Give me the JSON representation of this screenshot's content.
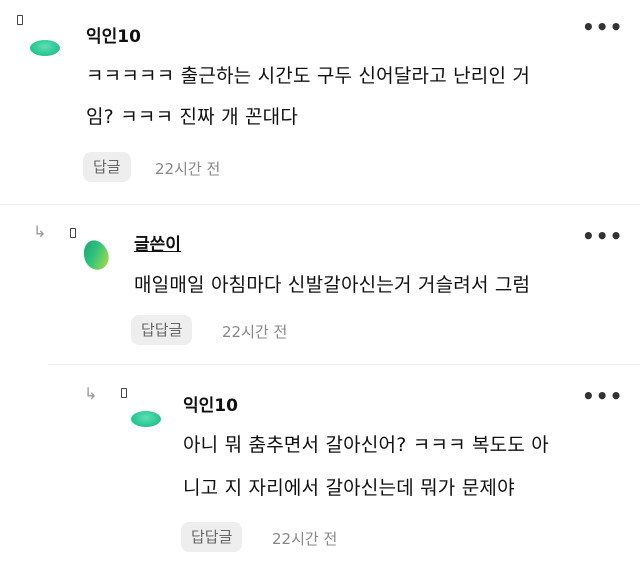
{
  "comments": [
    {
      "author": "익인10",
      "text_line1": "ㅋㅋㅋㅋㅋ 출근하는 시간도 구두 신어달라고 난리인 거",
      "text_line2": "임? ㅋㅋㅋ 진짜 개 꼰대다",
      "reply_label": "답글",
      "time": "22시간 전",
      "more": "•••"
    },
    {
      "author": "글쓴이",
      "text_line1": "매일매일 아침마다 신발갈아신는거 거슬려서 그럼",
      "reply_label": "답답글",
      "time": "22시간 전",
      "more": "•••"
    },
    {
      "author": "익인10",
      "text_line1": "아니 뭐 춤추면서 갈아신어? ㅋㅋㅋ 복도도 아",
      "text_line2": "니고 지 자리에서 갈아신는데 뭐가 문제야",
      "reply_label": "답답글",
      "time": "22시간 전",
      "more": "•••"
    }
  ],
  "icons": {
    "reply_arrow": "↳",
    "avatar_colors": {
      "mint": "#22c48e",
      "leaf": "#2fc27f"
    }
  }
}
